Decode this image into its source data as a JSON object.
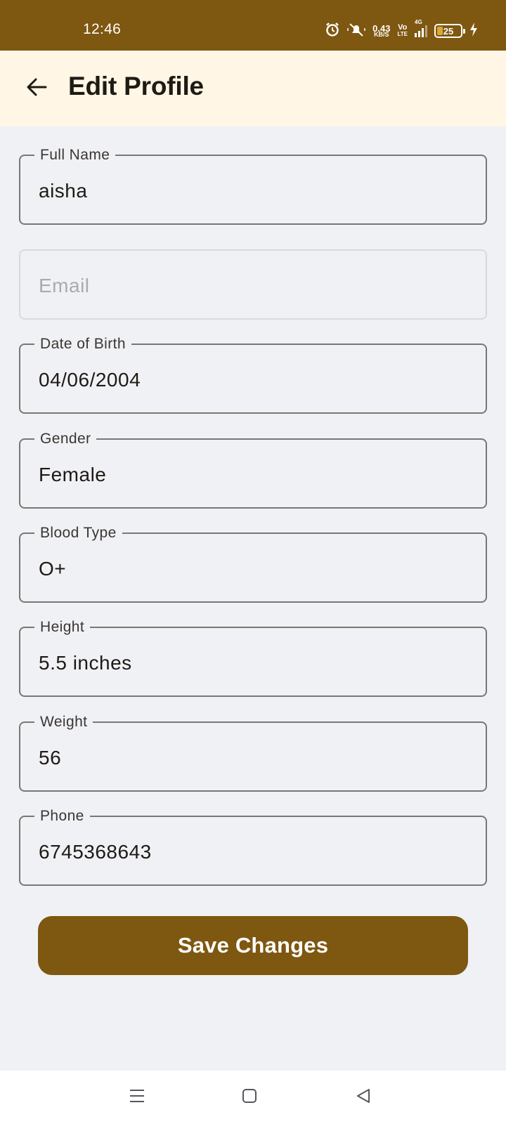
{
  "status_bar": {
    "time": "12:46",
    "net_speed": "0.43",
    "net_unit": "KB/S",
    "volte_top": "Vo",
    "volte_bottom": "LTE",
    "signal_label": "4G",
    "battery": "25",
    "icons": [
      "alarm-icon",
      "mute-icon",
      "signal-icon",
      "battery-icon",
      "charging-icon"
    ]
  },
  "app_bar": {
    "title": "Edit Profile",
    "back_icon": "arrow-left-icon"
  },
  "form": {
    "full_name": {
      "label": "Full Name",
      "value": "aisha"
    },
    "email": {
      "placeholder": "Email",
      "value": ""
    },
    "dob": {
      "label": "Date of Birth",
      "value": "04/06/2004"
    },
    "gender": {
      "label": "Gender",
      "value": "Female"
    },
    "blood_type": {
      "label": "Blood Type",
      "value": "O+"
    },
    "height": {
      "label": "Height",
      "value": "5.5 inches"
    },
    "weight": {
      "label": "Weight",
      "value": "56"
    },
    "phone": {
      "label": "Phone",
      "value": "6745368643"
    },
    "save_label": "Save Changes"
  },
  "nav_bar": {
    "icons": [
      "menu-icon",
      "home-icon",
      "back-icon"
    ]
  },
  "colors": {
    "primary": "#7E5710",
    "app_bar_bg": "#FFF6E5",
    "page_bg": "#F0F1F5",
    "outline": "#7A7672"
  }
}
